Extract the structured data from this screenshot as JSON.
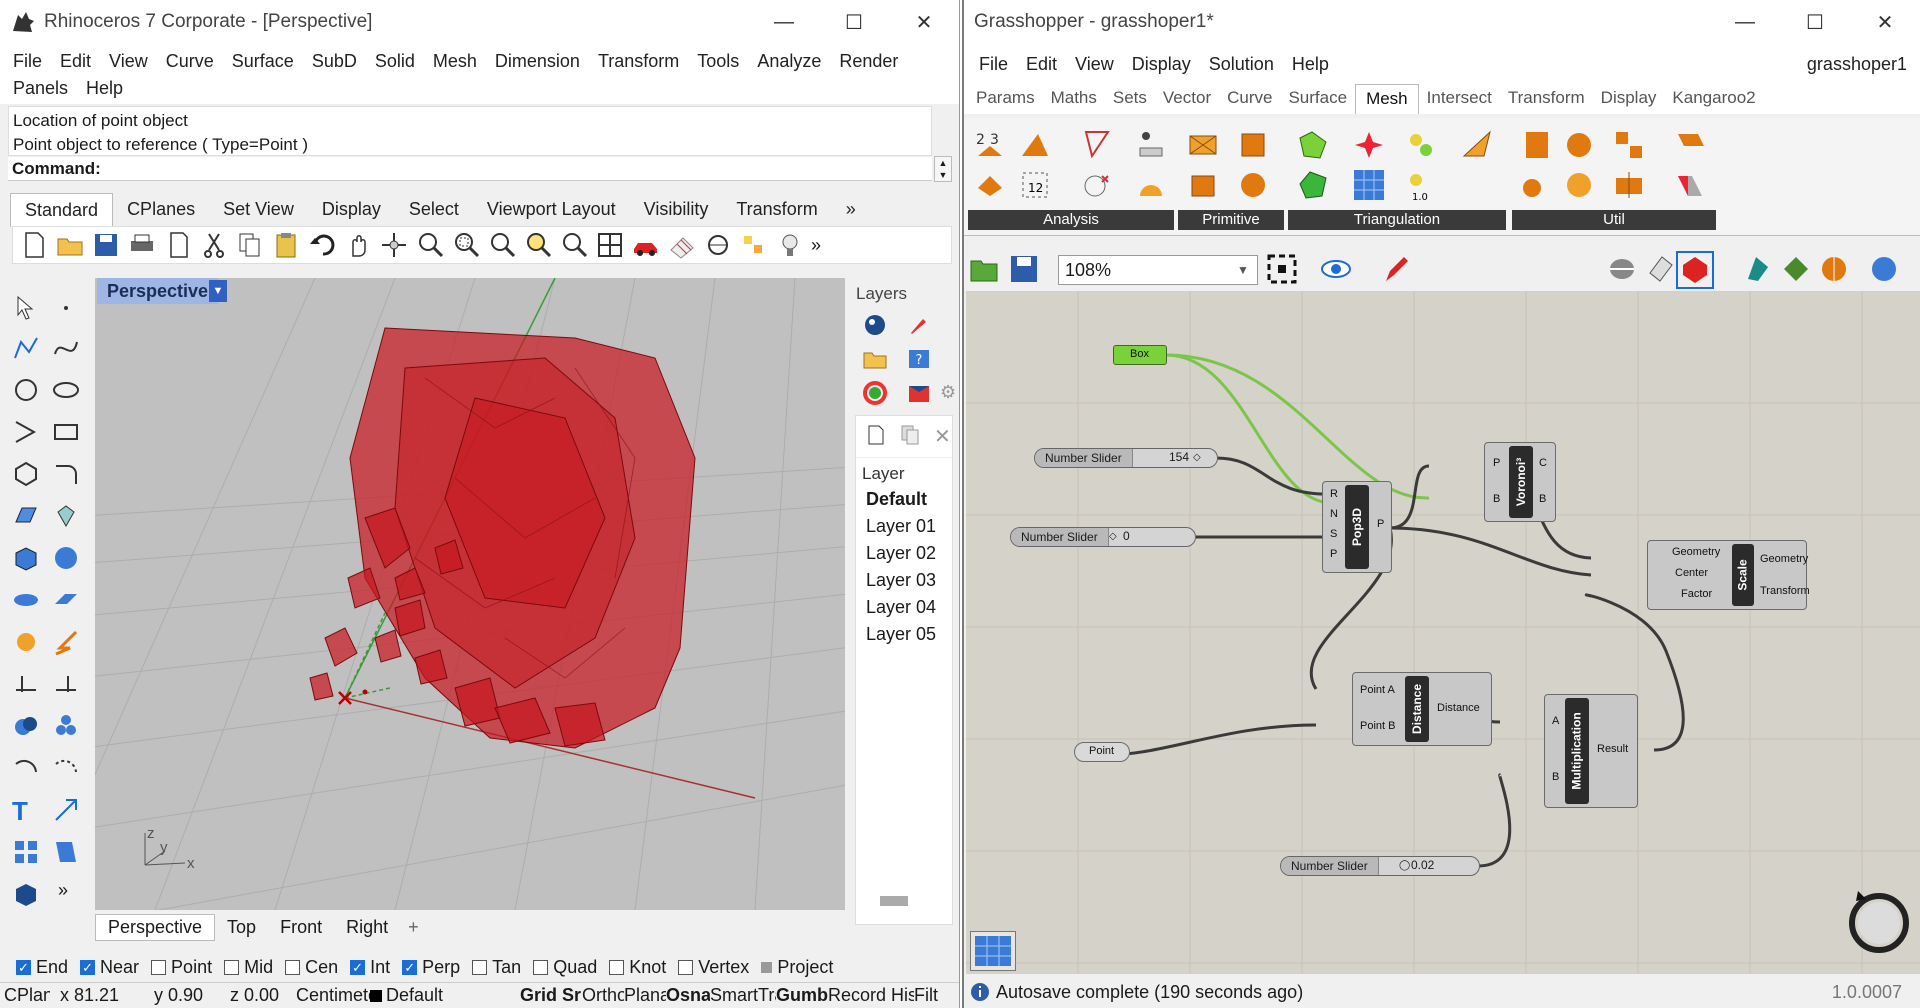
{
  "rhino": {
    "title": "Rhinoceros 7 Corporate - [Perspective]",
    "menu": [
      "File",
      "Edit",
      "View",
      "Curve",
      "Surface",
      "SubD",
      "Solid",
      "Mesh",
      "Dimension",
      "Transform",
      "Tools",
      "Analyze",
      "Render",
      "Panels",
      "Help"
    ],
    "command_history": [
      "Location of point object",
      "Point object to reference ( Type=Point )"
    ],
    "command_label": "Command:",
    "toolbar_tabs": [
      "Standard",
      "CPlanes",
      "Set View",
      "Display",
      "Select",
      "Viewport Layout",
      "Visibility",
      "Transform"
    ],
    "viewport_title": "Perspective",
    "viewport_tabs": [
      "Perspective",
      "Top",
      "Front",
      "Right"
    ],
    "layers_panel": {
      "title": "Layers",
      "column": "Layer",
      "items": [
        "Default",
        "Layer 01",
        "Layer 02",
        "Layer 03",
        "Layer 04",
        "Layer 05"
      ]
    },
    "osnaps": [
      {
        "label": "End",
        "checked": true
      },
      {
        "label": "Near",
        "checked": true
      },
      {
        "label": "Point",
        "checked": false
      },
      {
        "label": "Mid",
        "checked": false
      },
      {
        "label": "Cen",
        "checked": false
      },
      {
        "label": "Int",
        "checked": true
      },
      {
        "label": "Perp",
        "checked": true
      },
      {
        "label": "Tan",
        "checked": false
      },
      {
        "label": "Quad",
        "checked": false
      },
      {
        "label": "Knot",
        "checked": false
      },
      {
        "label": "Vertex",
        "checked": false
      }
    ],
    "osnap_project": "Project",
    "status": {
      "cplane": "CPlan",
      "x": "x 81.21",
      "y": "y 0.90",
      "z": "z 0.00",
      "units": "Centimete",
      "layer": "Default",
      "grid": "Grid Sr",
      "ortho": "Ortho",
      "planar": "Plana",
      "osnap": "Osna",
      "smarttrack": "SmartTra",
      "gumball": "Gumb",
      "record": "Record His",
      "filter": "Filt"
    },
    "axis_labels": {
      "z": "z",
      "y": "y",
      "x": "x"
    }
  },
  "gh": {
    "title": "Grasshopper - grasshoper1*",
    "menu": [
      "File",
      "Edit",
      "View",
      "Display",
      "Solution",
      "Help"
    ],
    "doc_name": "grasshoper1",
    "tabs": [
      "Params",
      "Maths",
      "Sets",
      "Vector",
      "Curve",
      "Surface",
      "Mesh",
      "Intersect",
      "Transform",
      "Display",
      "Kangaroo2"
    ],
    "active_tab": "Mesh",
    "groups": [
      "Analysis",
      "Primitive",
      "Triangulation",
      "Util"
    ],
    "zoom": "108%",
    "status_text": "Autosave complete (190 seconds ago)",
    "version": "1.0.0007",
    "nodes": {
      "box": "Box",
      "slider1": {
        "label": "Number Slider",
        "value": "154"
      },
      "slider2": {
        "label": "Number Slider",
        "value": "0"
      },
      "slider3": {
        "label": "Number Slider",
        "value": "0.02"
      },
      "pop3d": {
        "name": "Pop3D",
        "inputs": [
          "R",
          "N",
          "S",
          "P"
        ],
        "output": "P"
      },
      "voronoi": {
        "name": "Voronoi³",
        "inputs": [
          "P",
          "B"
        ],
        "outputs": [
          "C",
          "B"
        ]
      },
      "scale": {
        "name": "Scale",
        "inputs": [
          "Geometry",
          "Center",
          "Factor"
        ],
        "outputs": [
          "Geometry",
          "Transform"
        ]
      },
      "distance": {
        "name": "Distance",
        "inputs": [
          "Point A",
          "Point B"
        ],
        "output": "Distance"
      },
      "multiplication": {
        "name": "Multiplication",
        "inputs": [
          "A",
          "B"
        ],
        "output": "Result"
      },
      "point": "Point"
    }
  },
  "colors": {
    "accent": "#1a6dd6",
    "cells": "#c8171f",
    "gh_canvas": "#d5d2c9",
    "gh_green": "#7bd13a"
  }
}
